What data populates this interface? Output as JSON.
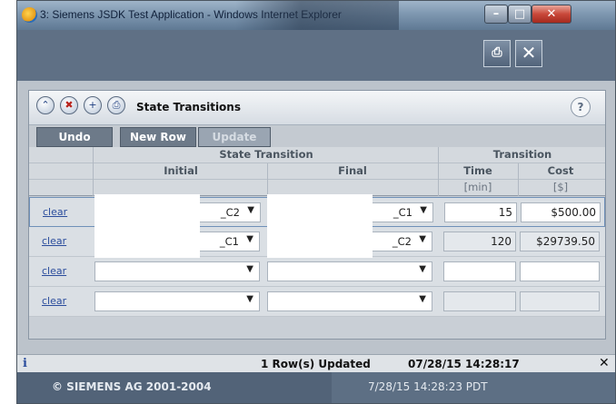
{
  "window": {
    "title": "3: Siemens JSDK Test Application - Windows Internet Explorer",
    "min_glyph": "–",
    "max_glyph": "□",
    "close_glyph": "✕"
  },
  "toolbar": {
    "print_glyph": "⎙",
    "close_glyph": "✕"
  },
  "panel": {
    "title": "State Transitions",
    "help_glyph": "?",
    "header_icons": [
      "collapse-icon",
      "delete-icon",
      "add-icon",
      "print-icon"
    ],
    "tabs": {
      "undo": "Undo",
      "new_row": "New Row",
      "update": "Update"
    }
  },
  "grid": {
    "group_headers": {
      "state_transition": "State Transition",
      "transition": "Transition"
    },
    "column_headers": {
      "initial": "Initial",
      "final": "Final",
      "time": "Time",
      "cost": "Cost"
    },
    "units": {
      "time": "[min]",
      "cost": "[$]"
    },
    "clear_label": "clear",
    "rows": [
      {
        "initial": "_C2",
        "final": "_C1",
        "time": "15",
        "cost": "$500.00"
      },
      {
        "initial": "_C1",
        "final": "_C2",
        "time": "120",
        "cost": "$29739.50"
      },
      {
        "initial": "",
        "final": "",
        "time": "",
        "cost": ""
      },
      {
        "initial": "",
        "final": "",
        "time": "",
        "cost": ""
      }
    ]
  },
  "status": {
    "info_glyph": "i",
    "message": "1 Row(s) Updated",
    "timestamp": "07/28/15 14:28:17",
    "dismiss_glyph": "✕"
  },
  "footer": {
    "copyright": "© SIEMENS AG 2001-2004",
    "datetime": "7/28/15 14:28:23 PDT"
  }
}
